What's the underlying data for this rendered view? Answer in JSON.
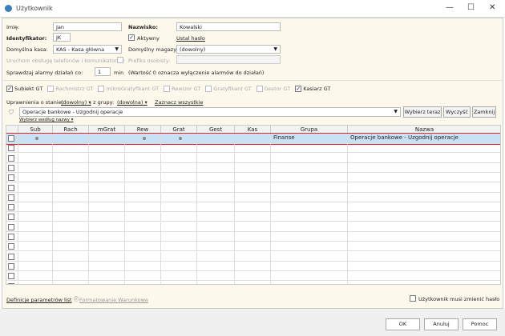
{
  "window": {
    "title": "Użytkownik",
    "minimize": "—",
    "maximize": "☐",
    "close": "✕"
  },
  "form": {
    "imie_label": "Imię:",
    "imie": "Jan",
    "nazwisko_label": "Nazwisko:",
    "nazwisko": "Kowalski",
    "ident_label": "Identyfikator:",
    "ident": "JK",
    "aktywny_label": "Aktywny",
    "aktywny": true,
    "ustal_haslo": "Ustal hasło",
    "kasa_label": "Domyślna kasa:",
    "kasa": "KAS - Kasa główna",
    "magazyn_label": "Domyślny magazyn:",
    "magazyn": "(dowolny)",
    "telefony_label": "Uruchom obsługę telefonów i komunikatorów",
    "prefiks_label": "Prefiks osobisty:",
    "alarmy_label": "Sprawdzaj alarmy działań co:",
    "alarmy": "1",
    "min": "min",
    "alarmy_note": "(Wartość 0 oznacza wyłączenie alarmów do działań)"
  },
  "apps": [
    {
      "label": "Subiekt GT",
      "checked": true,
      "enabled": true
    },
    {
      "label": "Rachmistrz GT",
      "checked": false,
      "enabled": false
    },
    {
      "label": "mikroGratyfikant GT",
      "checked": false,
      "enabled": false
    },
    {
      "label": "Rewizor GT",
      "checked": false,
      "enabled": false
    },
    {
      "label": "Gratyfikant GT",
      "checked": false,
      "enabled": false
    },
    {
      "label": "Gestor GT",
      "checked": false,
      "enabled": false
    },
    {
      "label": "Kasiarz GT",
      "checked": true,
      "enabled": true
    }
  ],
  "filters": {
    "stan_label": "Uprawnienia o stanie:",
    "stan": "(dowolny)",
    "grupa_label": ", z grupy:",
    "grupa": "(dowolna)",
    "zaznacz": "Zaznacz wszystkie"
  },
  "search": {
    "value": "Operacje bankowe - Uzgodnij operacje",
    "wybierz_teraz": "Wybierz teraz",
    "wyczysc": "Wyczyść",
    "zamknij": "Zamknij",
    "wybierz_wg": "Wybierz według nazwy"
  },
  "grid": {
    "columns": [
      "Sub",
      "Rach",
      "mGrat",
      "Rew",
      "Grat",
      "Gest",
      "Kas",
      "Grupa",
      "Nazwa"
    ],
    "rows": [
      {
        "checked": false,
        "Sub": true,
        "Rach": false,
        "mGrat": false,
        "Rew": true,
        "Grat": true,
        "Gest": false,
        "Kas": false,
        "Grupa": "Finanse",
        "Nazwa": "Operacje bankowe - Uzgodnij operacje",
        "selected": true
      }
    ]
  },
  "footer": {
    "definicje": "Definicje parametrów list",
    "formatowanie": "Formatowanie Warunkowe",
    "musi_zmienic": "Użytkownik musi zmienić hasło"
  },
  "buttons": {
    "ok": "OK",
    "anuluj": "Anuluj",
    "pomoc": "Pomoc"
  },
  "colors": {
    "form_bg": "#fdf8ec",
    "selected_row": "#c9e1f5",
    "selection_border": "#e0202a"
  }
}
